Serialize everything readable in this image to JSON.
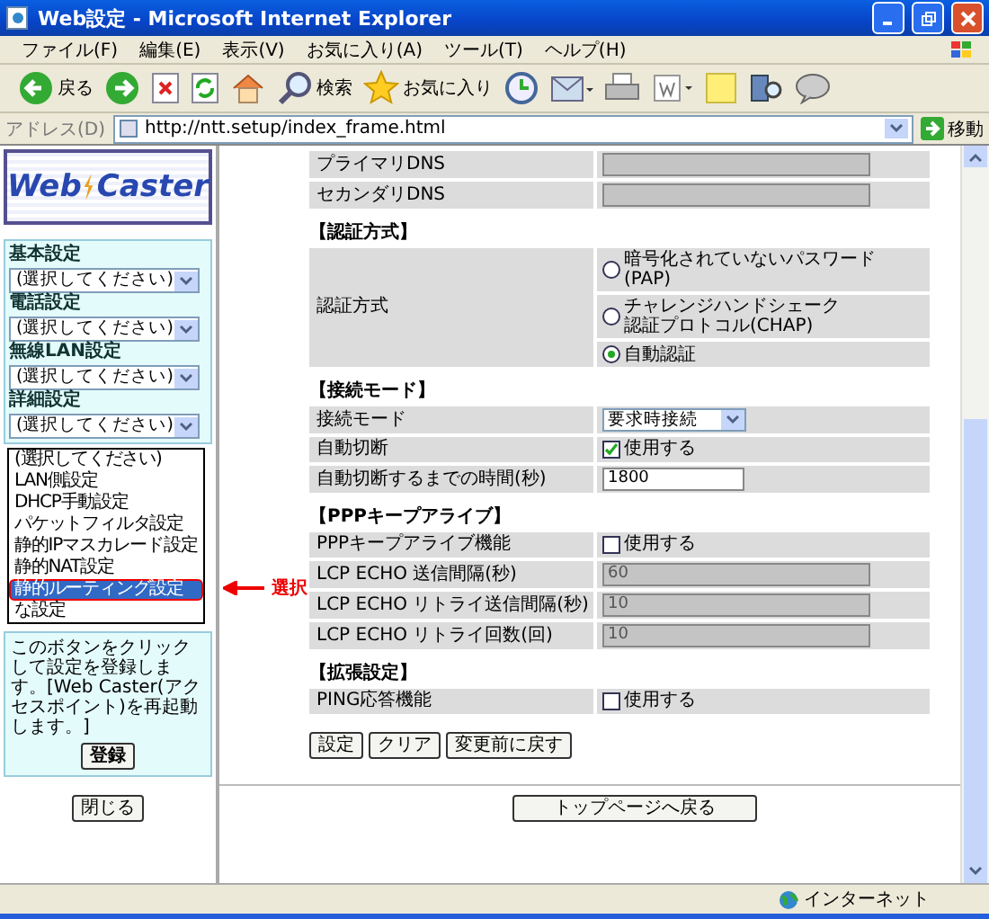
{
  "window": {
    "title": "Web設定 - Microsoft Internet Explorer"
  },
  "menu": [
    "ファイル(F)",
    "編集(E)",
    "表示(V)",
    "お気に入り(A)",
    "ツール(T)",
    "ヘルプ(H)"
  ],
  "toolbar": [
    {
      "kind": "back",
      "label": "戻る"
    },
    {
      "kind": "forward"
    },
    {
      "kind": "stop"
    },
    {
      "kind": "refresh"
    },
    {
      "kind": "home"
    },
    {
      "kind": "search",
      "label": "検索"
    },
    {
      "kind": "favorites",
      "label": "お気に入り"
    },
    {
      "kind": "history"
    },
    {
      "kind": "mail"
    },
    {
      "kind": "print"
    },
    {
      "kind": "edit"
    },
    {
      "kind": "note"
    },
    {
      "kind": "research"
    },
    {
      "kind": "messenger"
    }
  ],
  "address": {
    "label": "アドレス(D)",
    "value": "http://ntt.setup/index_frame.html",
    "go": "移動"
  },
  "sidebar": {
    "logo": [
      "Web",
      "Caster"
    ],
    "groups": [
      {
        "label": "基本設定",
        "value": "(選択してください)"
      },
      {
        "label": "電話設定",
        "value": "(選択してください)"
      },
      {
        "label": "無線LAN設定",
        "value": "(選択してください)"
      },
      {
        "label": "詳細設定",
        "value": "(選択してください)"
      }
    ],
    "dropdown": [
      {
        "label": "(選択してください)",
        "selected": false
      },
      {
        "label": "LAN側設定",
        "selected": false
      },
      {
        "label": "DHCP手動設定",
        "selected": false
      },
      {
        "label": "パケットフィルタ設定",
        "selected": false
      },
      {
        "label": "静的IPマスカレード設定",
        "selected": false
      },
      {
        "label": "静的NAT設定",
        "selected": false
      },
      {
        "label": "静的ルーティング設定",
        "selected": true
      },
      {
        "label": "な設定",
        "selected": false
      }
    ],
    "annotation": "選択",
    "notice": "このボタンをクリックして設定を登録します。[Web Caster(アクセスポイント)を再起動します。]",
    "register": "登録",
    "close": "閉じる"
  },
  "main": {
    "sections": [
      {
        "rows": [
          {
            "kind": "input",
            "label": "プライマリDNS",
            "value": "",
            "disabled": true
          },
          {
            "kind": "input",
            "label": "セカンダリDNS",
            "value": "",
            "disabled": true
          }
        ]
      },
      {
        "title": "【認証方式】",
        "rows": [
          {
            "kind": "radio",
            "label": "認証方式",
            "options": [
              {
                "lines": [
                  "暗号化されていないパスワード",
                  "(PAP)"
                ],
                "selected": false
              },
              {
                "lines": [
                  "チャレンジハンドシェーク",
                  "認証プロトコル(CHAP)"
                ],
                "selected": false
              },
              {
                "lines": [
                  "自動認証"
                ],
                "selected": true
              }
            ]
          }
        ]
      },
      {
        "title": "【接続モード】",
        "rows": [
          {
            "kind": "select",
            "label": "接続モード",
            "value": "要求時接続"
          },
          {
            "kind": "checkbox",
            "label": "自動切断",
            "text": "使用する",
            "checked": true
          },
          {
            "kind": "input",
            "label": "自動切断するまでの時間(秒)",
            "value": "1800",
            "disabled": false
          }
        ]
      },
      {
        "title": "【PPPキープアライブ】",
        "rows": [
          {
            "kind": "checkbox",
            "label": "PPPキープアライブ機能",
            "text": "使用する",
            "checked": false
          },
          {
            "kind": "input",
            "label": "LCP ECHO 送信間隔(秒)",
            "value": "60",
            "disabled": true
          },
          {
            "kind": "input",
            "label": "LCP ECHO リトライ送信間隔(秒)",
            "value": "10",
            "disabled": true
          },
          {
            "kind": "input",
            "label": "LCP ECHO リトライ回数(回)",
            "value": "10",
            "disabled": true
          }
        ]
      },
      {
        "title": "【拡張設定】",
        "rows": [
          {
            "kind": "checkbox",
            "label": "PING応答機能",
            "text": "使用する",
            "checked": false
          }
        ]
      }
    ],
    "buttons": [
      "設定",
      "クリア",
      "変更前に戻す"
    ],
    "top": "トップページへ戻る"
  },
  "status": {
    "zone": "インターネット"
  }
}
